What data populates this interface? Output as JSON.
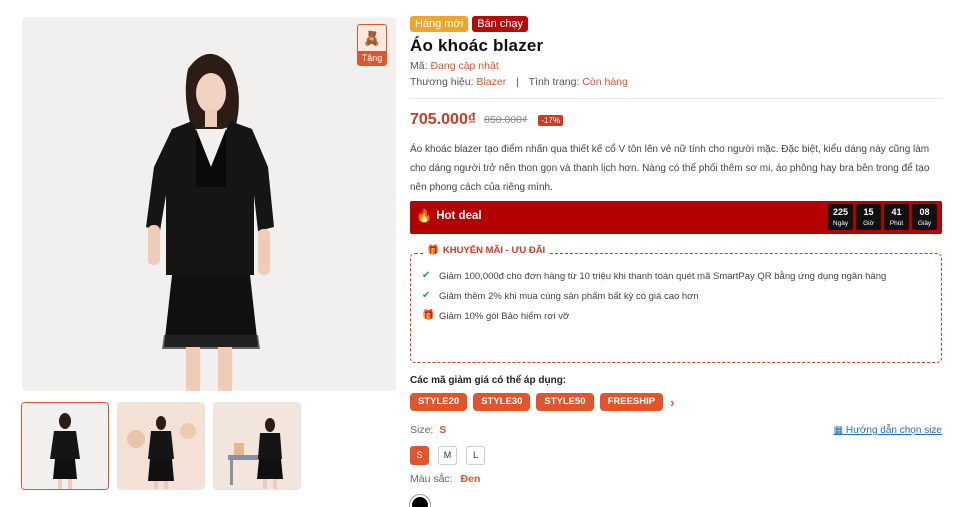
{
  "gallery": {
    "gift_label": "Tặng",
    "thumbnails": [
      "thumb-1",
      "thumb-2",
      "thumb-3"
    ]
  },
  "product": {
    "badges": {
      "new": "Hàng mới",
      "hot": "Bán chạy"
    },
    "title": "Áo khoác blazer",
    "sku_label": "Mã:",
    "sku_value": "Đang cập nhật",
    "brand_label": "Thương hiệu:",
    "brand_value": "Blazer",
    "separator": "|",
    "status_label": "Tình trạng:",
    "status_value": "Còn hàng",
    "price": "705.000₫",
    "old_price": "850.000₫",
    "discount": "-17%",
    "description": "Áo khoác blazer tạo điểm nhấn qua thiết kế cổ V tôn lên vẻ nữ tính cho người mặc. Đặc biệt, kiểu dáng này cũng làm cho dáng người trở nên thon gọn và thanh lịch hơn. Nàng có thể phối thêm sơ mi, áo phông hay bra bên trong để tạo nên phong cách của riêng mình."
  },
  "hot_deal": {
    "label": "Hot deal",
    "countdown": [
      {
        "value": "225",
        "unit": "Ngày"
      },
      {
        "value": "15",
        "unit": "Giờ"
      },
      {
        "value": "41",
        "unit": "Phút"
      },
      {
        "value": "08",
        "unit": "Giây"
      }
    ]
  },
  "promo": {
    "title": "KHUYẾN MÃI - ƯU ĐÃI",
    "items": [
      "Giảm 100,000đ cho đơn hàng từ 10 triệu khi thanh toán quét mã SmartPay QR bằng ứng dụng ngân hàng",
      "Giảm thêm 2% khi mua cùng sản phẩm bất kỳ có giá cao hơn",
      "Giảm 10% gói Bảo hiểm rơi vỡ"
    ]
  },
  "coupons": {
    "title": "Các mã giảm giá có thể áp dụng:",
    "codes": [
      "STYLE20",
      "STYLE30",
      "STYLE50",
      "FREESHIP"
    ],
    "more": "›"
  },
  "size": {
    "label": "Size:",
    "selected": "S",
    "guide": "Hướng dẫn chọn size",
    "options": [
      "S",
      "M",
      "L"
    ]
  },
  "color": {
    "label": "Màu sắc:",
    "selected": "Đen",
    "swatch": "#000000"
  },
  "colors": {
    "accent": "#e3542b",
    "deal_bg": "#b50000",
    "price": "#d23a1e"
  }
}
